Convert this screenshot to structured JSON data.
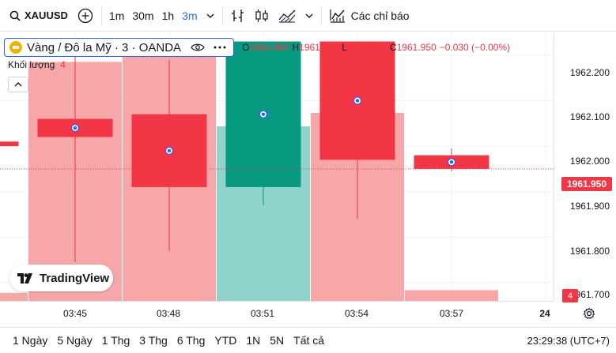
{
  "toolbar": {
    "symbol": "XAUUSD",
    "intervals": [
      "1m",
      "30m",
      "1h",
      "3m"
    ],
    "active_interval": "3m",
    "indicators_label": "Các chỉ báo"
  },
  "legend": {
    "symbol_title": "Vàng / Đô la Mỹ · 3 · OANDA",
    "ohlc": {
      "o_key": "O",
      "o": "1961.980",
      "h_key": "H",
      "h": "1961.995",
      "l_key": "L",
      "l": "1961.945",
      "c_key": "C",
      "c": "1961.950",
      "change": "−0.030 (−0.00%)"
    },
    "volume_label": "Khối lượng",
    "volume_value": "4"
  },
  "watermark": {
    "text": "TradingView"
  },
  "price_axis": {
    "labels": [
      "1962.200",
      "1962.100",
      "1962.000",
      "1961.900",
      "1961.800",
      "1961.700"
    ],
    "last_price": "1961.950",
    "volume_tag": "4"
  },
  "time_axis": {
    "labels": [
      "03:45",
      "03:48",
      "03:51",
      "03:54",
      "03:57",
      "24"
    ]
  },
  "bottom_bar": {
    "ranges": [
      "1 Ngày",
      "5 Ngày",
      "1 Thg",
      "3 Thg",
      "6 Thg",
      "YTD",
      "1N",
      "5N",
      "Tất cả"
    ],
    "clock": "23:29:38 (UTC+7)"
  },
  "colors": {
    "up": "#089981",
    "down": "#f23645",
    "vol_up": "#8fd3cb",
    "vol_down": "#f7a7a8",
    "accent": "#2962ff"
  },
  "chart_data": {
    "type": "candlestick",
    "x": [
      "03:42",
      "03:45",
      "03:48",
      "03:51",
      "03:54",
      "03:57"
    ],
    "open": [
      1962.01,
      1962.06,
      1962.07,
      1961.91,
      1962.23,
      1961.98
    ],
    "high": [
      1962.01,
      1962.2,
      1962.19,
      1962.23,
      1962.23,
      1961.995
    ],
    "low": [
      1962.0,
      1961.745,
      1961.77,
      1961.87,
      1961.84,
      1961.945
    ],
    "close": [
      1962.0,
      1962.02,
      1961.91,
      1962.23,
      1961.97,
      1961.95
    ],
    "volume": [
      3,
      89,
      93,
      65,
      70,
      4
    ],
    "ylim": [
      1961.66,
      1962.25
    ],
    "volume_max": 100,
    "last": 1961.95
  }
}
